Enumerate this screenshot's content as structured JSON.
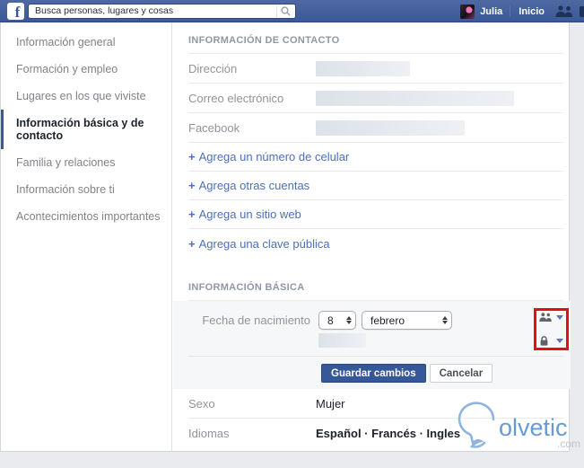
{
  "topbar": {
    "search_placeholder": "Busca personas, lugares y cosas",
    "user_name": "Julia",
    "home_label": "Inicio",
    "logo_letter": "f"
  },
  "sidebar": {
    "items": [
      {
        "label": "Información general",
        "active": false
      },
      {
        "label": "Formación y empleo",
        "active": false
      },
      {
        "label": "Lugares en los que viviste",
        "active": false
      },
      {
        "label": "Información básica y de contacto",
        "active": true
      },
      {
        "label": "Familia y relaciones",
        "active": false
      },
      {
        "label": "Información sobre ti",
        "active": false
      },
      {
        "label": "Acontecimientos importantes",
        "active": false
      }
    ]
  },
  "contact_section": {
    "title": "INFORMACIÓN DE CONTACTO",
    "plus_icon": "+",
    "rows": [
      {
        "label": "Dirección",
        "value_redacted": true
      },
      {
        "label": "Correo electrónico",
        "value_redacted": true
      },
      {
        "label": "Facebook",
        "value_redacted": true
      }
    ],
    "add_links": [
      "Agrega un número de celular",
      "Agrega otras cuentas",
      "Agrega un sitio web",
      "Agrega una clave pública"
    ]
  },
  "basic_section": {
    "title": "INFORMACIÓN BÁSICA",
    "birthday_label": "Fecha de nacimiento",
    "day_value": "8",
    "month_value": "febrero",
    "birth_year_redacted": true,
    "save_label": "Guardar cambios",
    "cancel_label": "Cancelar"
  },
  "display_rows": [
    {
      "label": "Sexo",
      "value": "Mujer"
    },
    {
      "label": "Idiomas",
      "value": "Español · Francés · Ingles"
    }
  ],
  "watermark": {
    "brand": "olvetic",
    "tld": ".com"
  },
  "colors": {
    "topbar_blue": "#3b5998",
    "link_blue": "#4c70ba",
    "save_button_blue": "#365899",
    "active_item_bar": "#3b5998",
    "highlight_red": "#e50f0f",
    "section_header_gray": "#9197a3",
    "page_background": "#e9ebee"
  }
}
